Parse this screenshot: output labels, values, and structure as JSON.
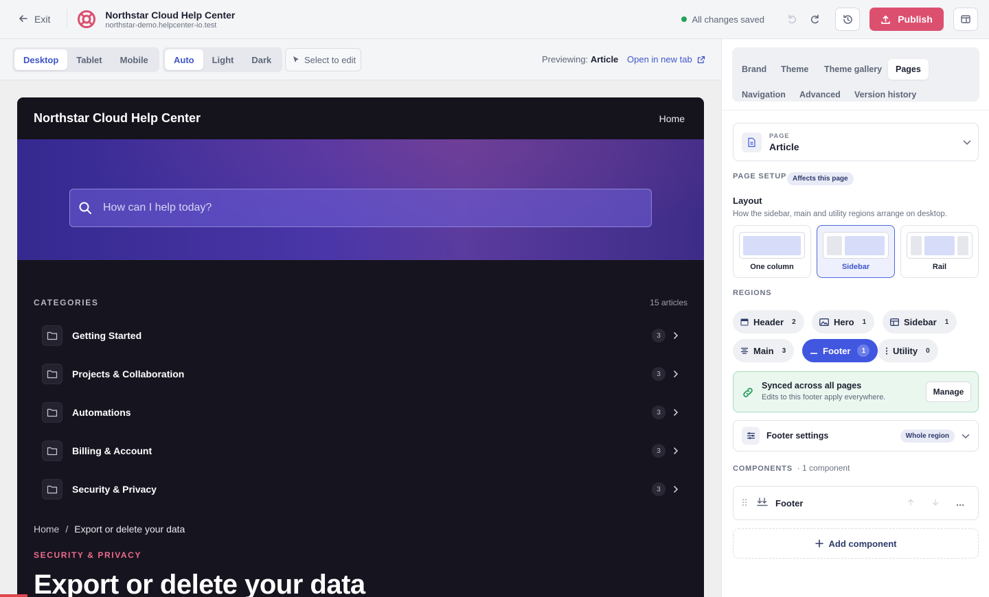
{
  "topbar": {
    "exit_label": "Exit",
    "app_title": "Northstar Cloud Help Center",
    "app_subtitle": "northstar-demo.helpcenter-io.test",
    "save_status": "All changes saved",
    "publish_label": "Publish"
  },
  "toolbar": {
    "devices": [
      "Desktop",
      "Tablet",
      "Mobile"
    ],
    "active_device": "Desktop",
    "themes": [
      "Auto",
      "Light",
      "Dark"
    ],
    "active_theme": "Auto",
    "select_to_edit": "Select to edit",
    "previewing_label": "Previewing:",
    "previewing_value": "Article",
    "open_new_tab": "Open in new tab"
  },
  "site": {
    "title": "Northstar Cloud Help Center",
    "nav_home": "Home",
    "search_placeholder": "How can I help today?",
    "categories_title": "CATEGORIES",
    "categories_count": "15 articles",
    "categories": [
      {
        "name": "Getting Started",
        "count": "3"
      },
      {
        "name": "Projects & Collaboration",
        "count": "3"
      },
      {
        "name": "Automations",
        "count": "3"
      },
      {
        "name": "Billing & Account",
        "count": "3"
      },
      {
        "name": "Security & Privacy",
        "count": "3"
      }
    ],
    "breadcrumb_home": "Home",
    "breadcrumb_sep": "/",
    "breadcrumb_current": "Export or delete your data",
    "article_kicker": "SECURITY & PRIVACY",
    "article_title": "Export or delete your data"
  },
  "panel": {
    "tabs_row1": [
      "Brand",
      "Theme",
      "Theme gallery",
      "Pages"
    ],
    "tabs_row2": [
      "Navigation",
      "Advanced",
      "Version history"
    ],
    "active_tab": "Pages",
    "page_label": "PAGE",
    "page_value": "Article",
    "page_setup_label": "PAGE SETUP",
    "page_setup_badge": "Affects this page",
    "layout_title": "Layout",
    "layout_desc": "How the sidebar, main and utility regions arrange on desktop.",
    "layouts": [
      {
        "label": "One column"
      },
      {
        "label": "Sidebar"
      },
      {
        "label": "Rail"
      }
    ],
    "active_layout": "Sidebar",
    "regions_label": "REGIONS",
    "regions": [
      {
        "name": "Header",
        "count": "2"
      },
      {
        "name": "Hero",
        "count": "1"
      },
      {
        "name": "Sidebar",
        "count": "1"
      },
      {
        "name": "Main",
        "count": "3"
      },
      {
        "name": "Footer",
        "count": "1"
      },
      {
        "name": "Utility",
        "count": "0"
      }
    ],
    "active_region": "Footer",
    "synced_title": "Synced across all pages",
    "synced_sub": "Edits to this footer apply everywhere.",
    "manage_label": "Manage",
    "footer_settings_title": "Footer settings",
    "footer_settings_badge": "Whole region",
    "components_label": "COMPONENTS",
    "components_count": "· 1 component",
    "component_name": "Footer",
    "add_component": "Add component"
  },
  "colors": {
    "accent": "#4157e0",
    "publish": "#dc4f6f",
    "saved_dot": "#22a356",
    "kicker": "#ef6b8d"
  }
}
